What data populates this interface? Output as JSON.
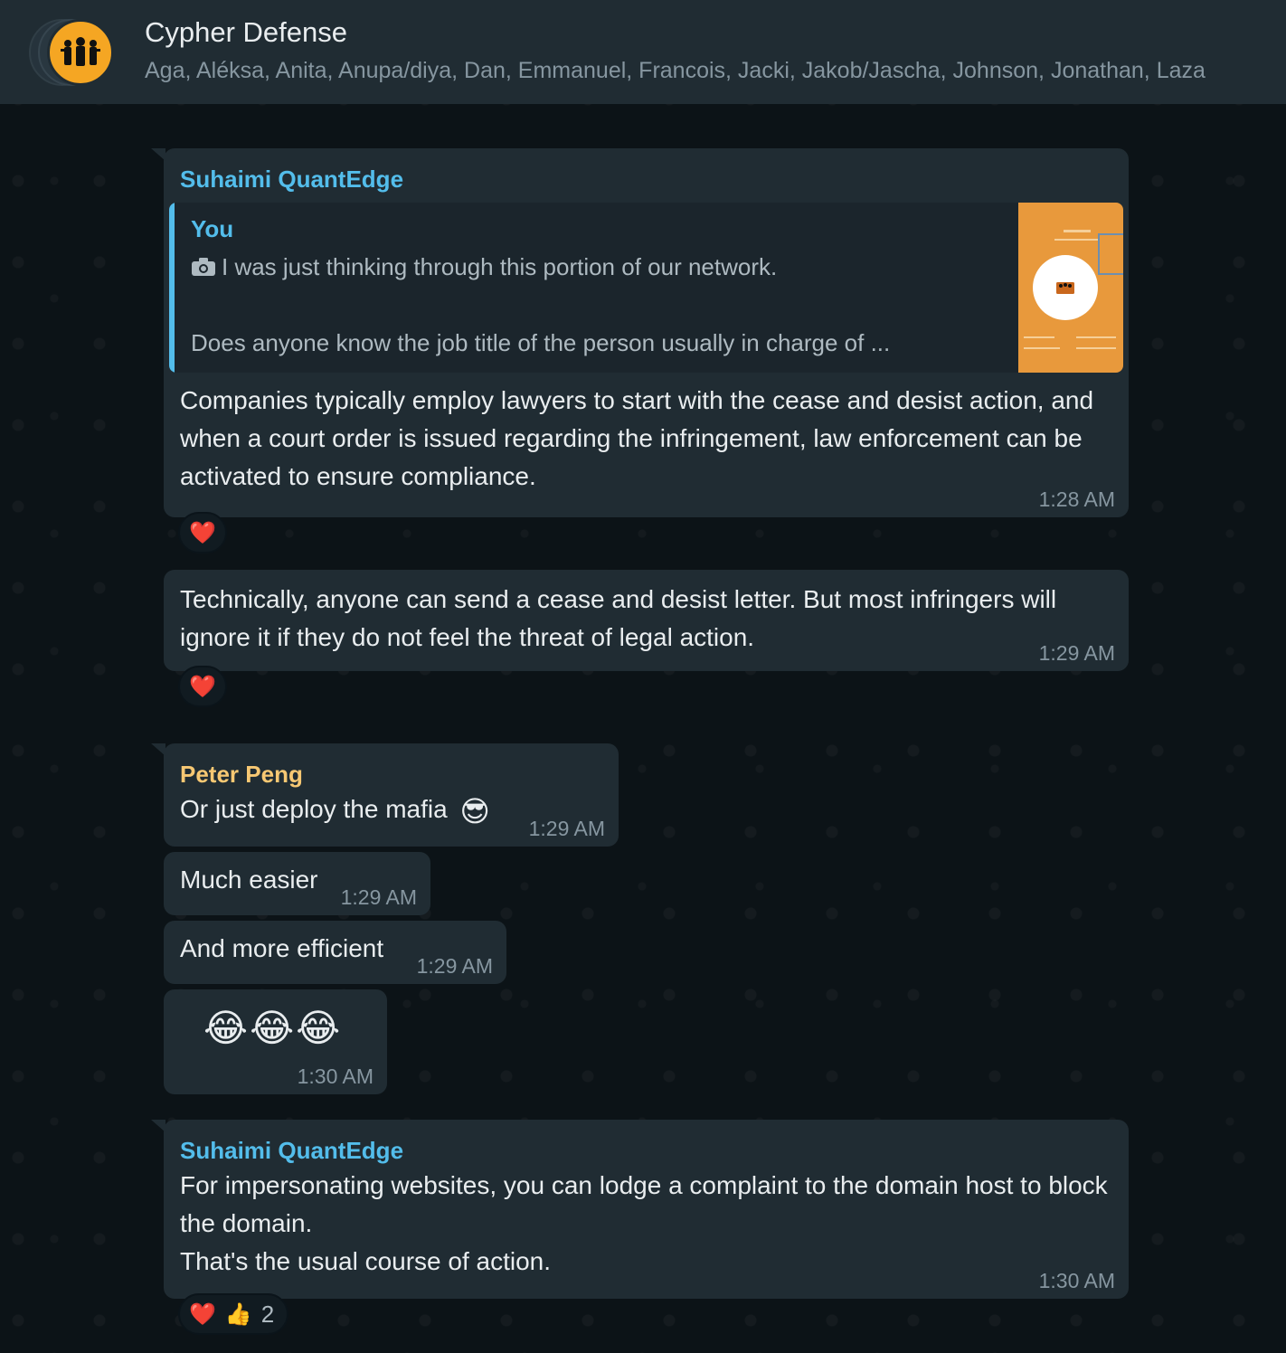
{
  "header": {
    "title": "Cypher Defense",
    "members": "Aga, Aléksa, Anita, Anupa/diya, Dan, Emmanuel, Francois, Jacki, Jakob/Jascha, Johnson, Jonathan, Laza"
  },
  "messages": {
    "m1": {
      "sender": "Suhaimi QuantEdge",
      "quote_sender": "You",
      "quote_line1": "I was just thinking through this portion of our network.",
      "quote_line2": "Does anyone know the job title of the person usually in charge of ...",
      "text": "Companies typically employ lawyers to start with the cease and desist action, and when a court order is issued regarding the infringement, law enforcement can be activated to ensure compliance.",
      "time": "1:28 AM",
      "reaction": "❤️"
    },
    "m2": {
      "text": "Technically, anyone can send a cease and desist letter. But most infringers will ignore it if they do not feel the threat of legal action.",
      "time": "1:29 AM",
      "reaction": "❤️"
    },
    "m3": {
      "sender": "Peter Peng",
      "text": "Or just deploy the mafia",
      "emoji": "😎",
      "time": "1:29 AM"
    },
    "m4": {
      "text": "Much easier",
      "time": "1:29 AM"
    },
    "m5": {
      "text": "And more efficient",
      "time": "1:29 AM"
    },
    "m6": {
      "emojis": "😂😂😂",
      "time": "1:30 AM"
    },
    "m7": {
      "sender": "Suhaimi QuantEdge",
      "text_line1": "For impersonating websites, you can lodge a complaint to the domain host to block the domain.",
      "text_line2": "That's the usual course of action.",
      "time": "1:30 AM",
      "reaction_heart": "❤️",
      "reaction_thumb": "👍",
      "reaction_count": "2"
    }
  },
  "colors": {
    "header_bg": "#202c33",
    "bubble_bg": "#202c33",
    "chat_bg": "#0c1317",
    "sender_blue": "#53bdeb",
    "sender_gold": "#f7c873",
    "timestamp": "#8696a0",
    "avatar_orange": "#f5a623"
  },
  "icons": {
    "camera": "camera-icon",
    "group_avatar": "group-avatar-icon"
  }
}
